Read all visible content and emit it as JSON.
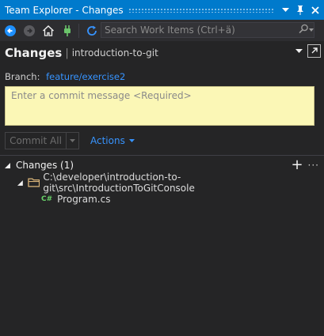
{
  "window": {
    "title": "Team Explorer - Changes",
    "buttons": [
      "chevron-down",
      "pin",
      "close"
    ],
    "accent": "#007acc",
    "background": "#252526"
  },
  "toolbar": {
    "icons": [
      "back-icon",
      "forward-icon",
      "home-icon",
      "plug-icon",
      "refresh-icon"
    ],
    "search_placeholder": "Search Work Items (Ctrl+ä)"
  },
  "header": {
    "page_title": "Changes",
    "separator": "|",
    "repository": "introduction-to-git"
  },
  "branch": {
    "label": "Branch:",
    "name": "feature/exercise2"
  },
  "commit": {
    "message_placeholder": "Enter a commit message <Required>",
    "commit_all_label": "Commit All",
    "actions_label": "Actions"
  },
  "changes": {
    "section_label": "Changes (1)",
    "add_symbol": "+",
    "more_symbol": "···",
    "folder_path": "C:\\developer\\introduction-to-git\\src\\IntroductionToGitConsole",
    "file_badge": "C#",
    "file_name": "Program.cs"
  }
}
